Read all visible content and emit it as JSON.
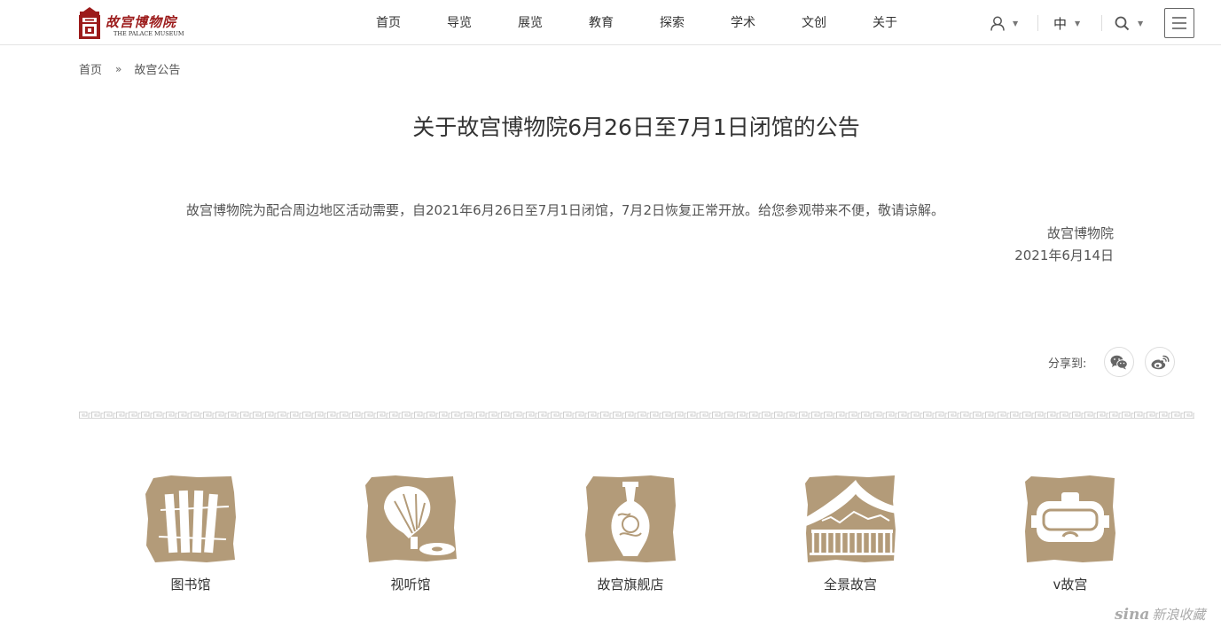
{
  "header": {
    "logo": {
      "name_cn": "故宫博物院",
      "name_en": "THE PALACE MUSEUM"
    },
    "nav": [
      "首页",
      "导览",
      "展览",
      "教育",
      "探索",
      "学术",
      "文创",
      "关于"
    ],
    "tools": {
      "user_icon": "user-icon",
      "language": "中",
      "search_icon": "search-icon",
      "menu_icon": "hamburger-menu-icon"
    }
  },
  "breadcrumb": {
    "home": "首页",
    "separator": "»",
    "current": "故宫公告"
  },
  "article": {
    "title": "关于故宫博物院6月26日至7月1日闭馆的公告",
    "body": "故宫博物院为配合周边地区活动需要，自2021年6月26日至7月1日闭馆，7月2日恢复正常开放。给您参观带来不便，敬请谅解。",
    "signer": "故宫博物院",
    "date": "2021年6月14日"
  },
  "share": {
    "label": "分享到:",
    "targets": [
      "wechat-icon",
      "weibo-icon"
    ]
  },
  "links": [
    {
      "label": "图书馆",
      "icon": "library-books-icon"
    },
    {
      "label": "视听馆",
      "icon": "gramophone-icon"
    },
    {
      "label": "故宫旗舰店",
      "icon": "vase-icon"
    },
    {
      "label": "全景故宫",
      "icon": "palace-building-icon"
    },
    {
      "label": "v故宫",
      "icon": "vr-headset-icon"
    }
  ],
  "watermark": {
    "brand": "sina",
    "text": "新浪收藏"
  },
  "colors": {
    "brand_red": "#9c1b1b",
    "badge_brown": "#b39b79",
    "text": "#333333",
    "muted_text": "#555555"
  }
}
